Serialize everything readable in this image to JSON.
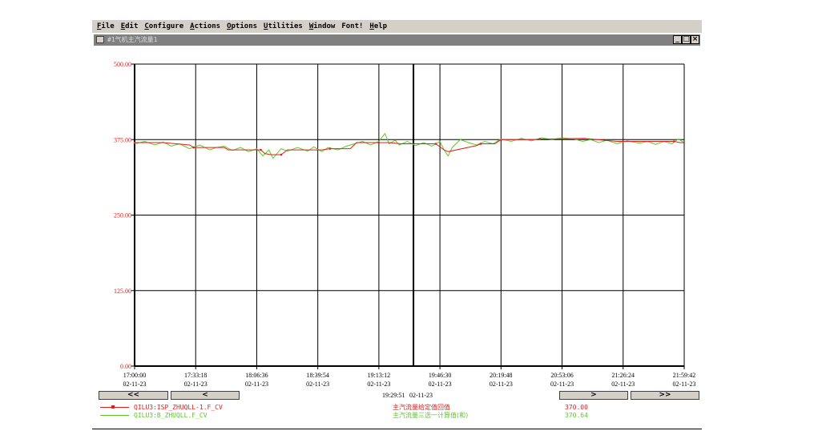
{
  "menu": [
    {
      "u": "F",
      "rest": "ile"
    },
    {
      "u": "E",
      "rest": "dit"
    },
    {
      "u": "C",
      "rest": "onfigure"
    },
    {
      "u": "A",
      "rest": "ctions"
    },
    {
      "u": "O",
      "rest": "ptions"
    },
    {
      "u": "U",
      "rest": "tilities"
    },
    {
      "u": "W",
      "rest": "indow"
    },
    {
      "u": "",
      "rest": "Font!"
    },
    {
      "u": "H",
      "rest": "elp"
    }
  ],
  "window": {
    "title": "#1气机主汽流量1",
    "minimize": "_",
    "restore": "□",
    "close": "×"
  },
  "nav": {
    "first": "<<",
    "prev": "<",
    "next": ">",
    "last": ">>"
  },
  "cursor": {
    "time": "19:29:51",
    "date": "02-11-23"
  },
  "colors": {
    "series1": "#e0201c",
    "series2": "#5ec82a",
    "grid": "#000000"
  },
  "legend": [
    {
      "tag": "QILU3:ISP_ZHUQLL-1.F_CV",
      "desc": "主汽流量给定值回值",
      "value": "370.00",
      "color": "#e0201c"
    },
    {
      "tag": "QILU3:B_ZHUQLL.F_CV",
      "desc": "主汽流量三选一计算值(和)",
      "value": "370.64",
      "color": "#5ec82a"
    }
  ],
  "chart_data": {
    "type": "line",
    "ylim": [
      0,
      500
    ],
    "yticks": [
      "0.00",
      "125.00",
      "250.00",
      "375.00",
      "500.00"
    ],
    "xticks": [
      {
        "time": "17:00:00",
        "date": "02-11-23"
      },
      {
        "time": "17:33:18",
        "date": "02-11-23"
      },
      {
        "time": "18:06:36",
        "date": "02-11-23"
      },
      {
        "time": "18:39:54",
        "date": "02-11-23"
      },
      {
        "time": "19:13:12",
        "date": "02-11-23"
      },
      {
        "time": "19:46:30",
        "date": "02-11-23"
      },
      {
        "time": "20:19:48",
        "date": "02-11-23"
      },
      {
        "time": "20:53:06",
        "date": "02-11-23"
      },
      {
        "time": "21:26:24",
        "date": "02-11-23"
      },
      {
        "time": "21:59:42",
        "date": "02-11-23"
      }
    ],
    "cursor_time": "19:29:51",
    "series": [
      {
        "tag": "QILU3:ISP_ZHUQLL-1.F_CV",
        "x": [
          0,
          14,
          27,
          29,
          44,
          46,
          62,
          64,
          67,
          72,
          75,
          78,
          92,
          96,
          106,
          109,
          120,
          125,
          131,
          142,
          148,
          152,
          154,
          168,
          170,
          177,
          180,
          196,
          199,
          203,
          221,
          237,
          265,
          268,
          270
        ],
        "y": [
          370,
          370,
          366,
          362,
          362,
          358,
          358,
          352,
          350,
          350,
          358,
          358,
          358,
          360,
          360,
          370,
          370,
          370,
          368,
          368,
          368,
          358,
          355,
          365,
          368,
          368,
          375,
          375,
          376,
          376,
          377,
          372,
          372,
          370,
          370
        ]
      },
      {
        "tag": "QILU3:B_ZHUQLL.F_CV",
        "x": [
          0,
          5,
          10,
          14,
          18,
          22,
          27,
          32,
          37,
          40,
          44,
          48,
          52,
          56,
          60,
          63,
          66,
          68,
          72,
          75,
          80,
          85,
          88,
          92,
          95,
          100,
          104,
          108,
          112,
          116,
          120,
          123,
          125,
          128,
          130,
          134,
          138,
          142,
          146,
          150,
          152,
          154,
          156,
          160,
          164,
          168,
          172,
          176,
          180,
          185,
          190,
          195,
          200,
          205,
          210,
          216,
          220,
          224,
          228,
          232,
          237,
          242,
          248,
          252,
          256,
          260,
          264,
          267,
          270
        ],
        "y": [
          368,
          372,
          366,
          371,
          364,
          368,
          360,
          366,
          358,
          362,
          364,
          357,
          362,
          355,
          360,
          348,
          358,
          344,
          360,
          356,
          362,
          356,
          363,
          355,
          362,
          358,
          364,
          368,
          372,
          366,
          372,
          385,
          368,
          374,
          366,
          372,
          365,
          370,
          364,
          372,
          358,
          348,
          362,
          375,
          370,
          366,
          372,
          368,
          376,
          372,
          377,
          373,
          378,
          375,
          378,
          376,
          372,
          375,
          370,
          374,
          368,
          373,
          369,
          372,
          367,
          372,
          368,
          376,
          370
        ]
      }
    ],
    "grid": true
  }
}
